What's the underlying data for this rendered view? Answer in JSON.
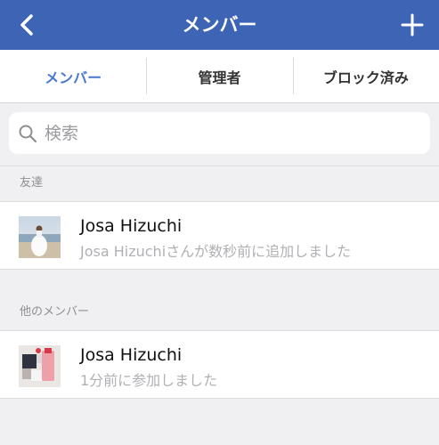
{
  "navbar": {
    "title": "メンバー",
    "back_icon": "chevron-left-icon",
    "add_icon": "plus-icon",
    "color": "#3e64b6"
  },
  "tabs": [
    {
      "label": "メンバー",
      "active": true
    },
    {
      "label": "管理者",
      "active": false
    },
    {
      "label": "ブロック済み",
      "active": false
    }
  ],
  "search": {
    "placeholder": "検索",
    "value": "",
    "icon": "search-icon"
  },
  "sections": [
    {
      "header": "友達",
      "members": [
        {
          "name": "Josa Hizuchi",
          "status": "Josa Hizuchiさんが数秒前に追加しました",
          "avatar": "beach-photo"
        }
      ]
    },
    {
      "header": "他のメンバー",
      "members": [
        {
          "name": "Josa Hizuchi",
          "status": "1分前に参加しました",
          "avatar": "cosmetics-photo"
        }
      ]
    }
  ]
}
